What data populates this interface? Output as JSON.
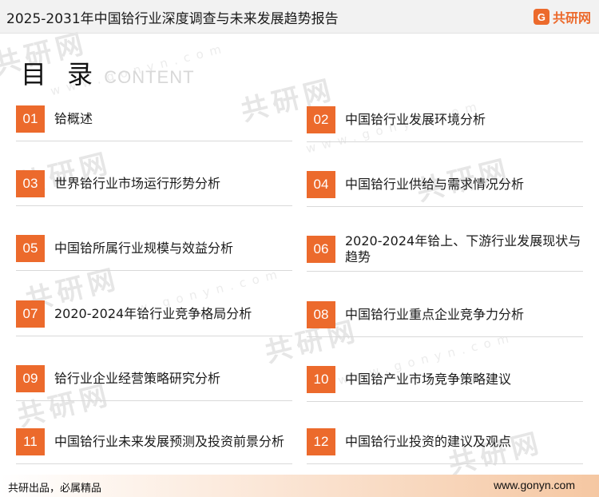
{
  "header": {
    "title": "2025-2031年中国铪行业深度调查与未来发展趋势报告",
    "brand_icon": "G",
    "brand_name": "共研网"
  },
  "toc": {
    "title": "目 录",
    "subtitle": "CONTENT",
    "items": [
      {
        "num": "01",
        "label": "铪概述"
      },
      {
        "num": "02",
        "label": "中国铪行业发展环境分析"
      },
      {
        "num": "03",
        "label": "世界铪行业市场运行形势分析"
      },
      {
        "num": "04",
        "label": "中国铪行业供给与需求情况分析"
      },
      {
        "num": "05",
        "label": "中国铪所属行业规模与效益分析"
      },
      {
        "num": "06",
        "label": "2020-2024年铪上、下游行业发展现状与趋势"
      },
      {
        "num": "07",
        "label": "2020-2024年铪行业竞争格局分析"
      },
      {
        "num": "08",
        "label": "中国铪行业重点企业竞争力分析"
      },
      {
        "num": "09",
        "label": "铪行业企业经营策略研究分析"
      },
      {
        "num": "10",
        "label": "中国铪产业市场竞争策略建议"
      },
      {
        "num": "11",
        "label": "中国铪行业未来发展预测及投资前景分析"
      },
      {
        "num": "12",
        "label": "中国铪行业投资的建议及观点"
      }
    ]
  },
  "footer": {
    "slogan": "共研出品，必属精品",
    "website": "www.gonyn.com"
  },
  "colors": {
    "accent": "#ec6a2c",
    "header_bg": "#f2f2f2"
  }
}
